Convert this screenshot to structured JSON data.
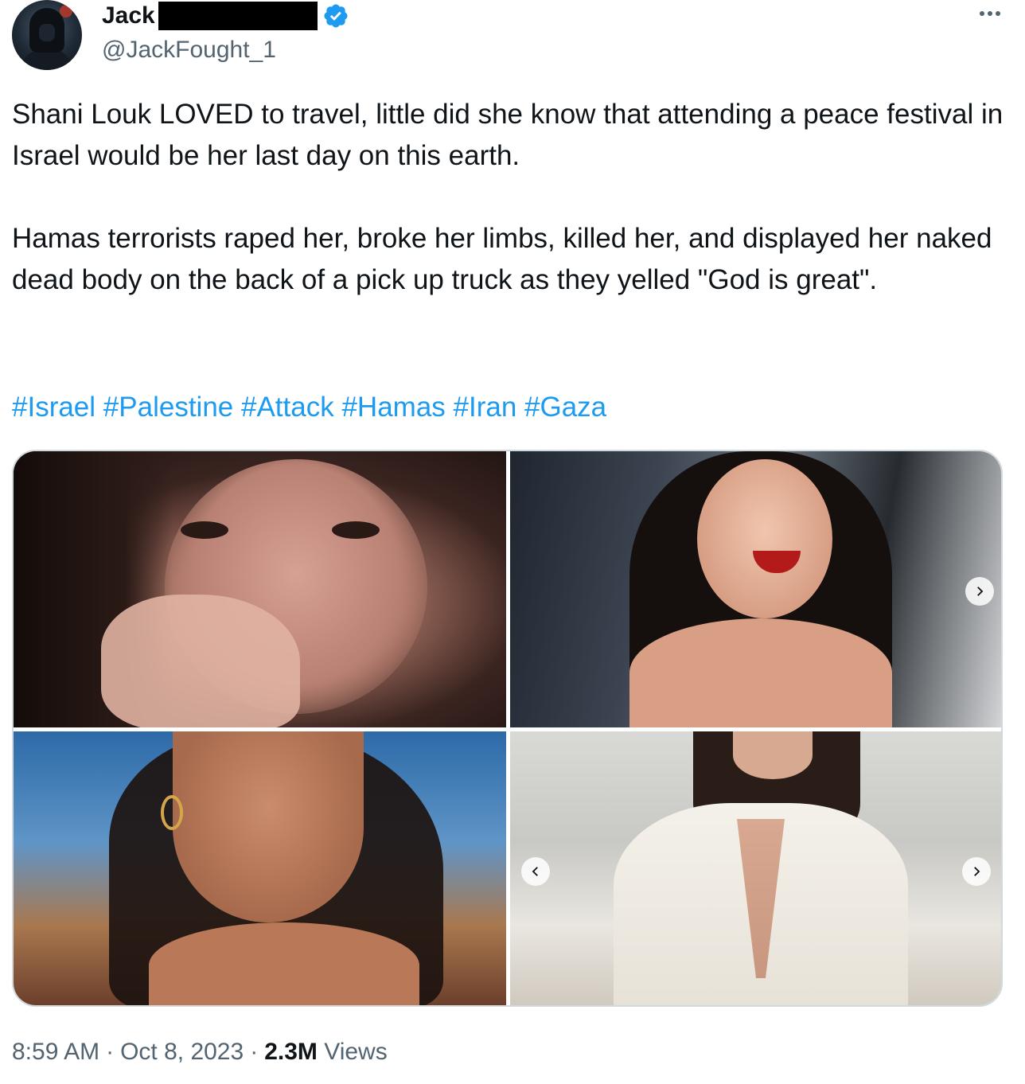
{
  "author": {
    "display_name": "Jack",
    "handle": "@JackFought_1",
    "verified": true
  },
  "icons": {
    "verified": "verified-badge-icon",
    "more": "more-options-icon",
    "next": "chevron-right-icon",
    "prev": "chevron-left-icon"
  },
  "tweet": {
    "paragraph1": "Shani Louk LOVED to travel, little did she know that attending a peace festival in Israel would be her last day on this earth.",
    "paragraph2": "Hamas terrorists raped her, broke her limbs, killed her, and displayed her naked dead body on the back of a pick up truck as they yelled \"God is great\".",
    "hashtags": [
      "#Israel",
      "#Palestine",
      "#Attack",
      "#Hamas",
      "#Iran",
      "#Gaza"
    ]
  },
  "meta": {
    "time": "8:59 AM",
    "date": "Oct 8, 2023",
    "views_count": "2.3M",
    "views_label": "Views"
  },
  "colors": {
    "link": "#1d9bf0",
    "secondary_text": "#536471",
    "verified": "#1d9bf0"
  }
}
